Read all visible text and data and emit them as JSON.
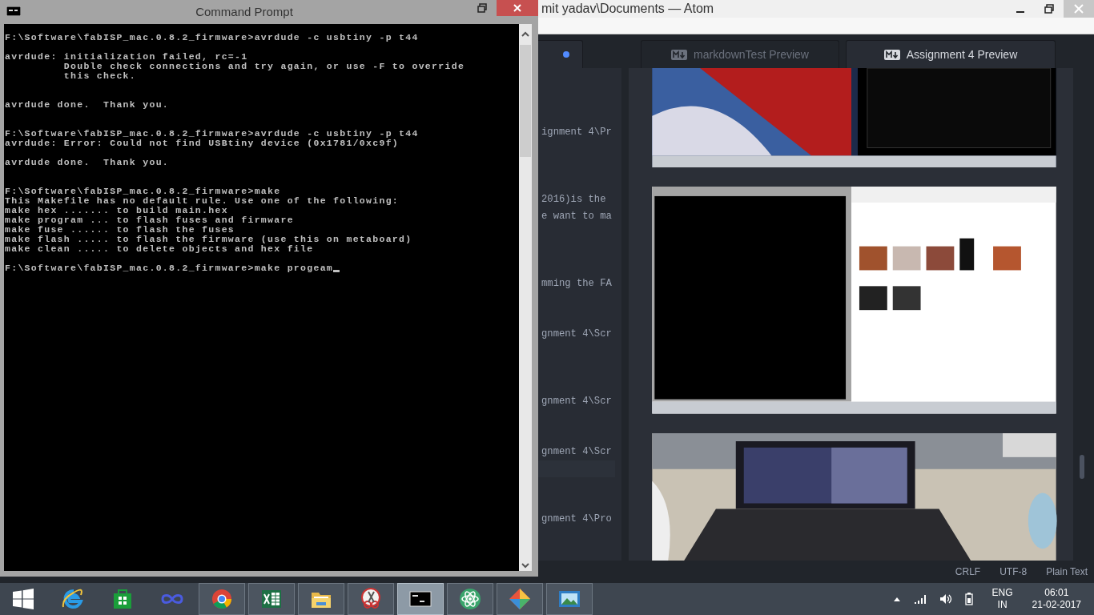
{
  "atom_window": {
    "title": "mit yadav\\Documents — Atom",
    "editor_pane": {
      "tab": {
        "modified": true
      },
      "lines": [
        {
          "kind": "blank"
        },
        {
          "kind": "blank"
        },
        {
          "kind": "blank"
        },
        {
          "kind": "text",
          "text": "ignment 4\\Pr"
        },
        {
          "kind": "blank"
        },
        {
          "kind": "blank"
        },
        {
          "kind": "blank"
        },
        {
          "kind": "text",
          "text": "2016)is the"
        },
        {
          "kind": "text",
          "text": "e want to ma"
        },
        {
          "kind": "blank"
        },
        {
          "kind": "blank"
        },
        {
          "kind": "blank"
        },
        {
          "kind": "text",
          "text": "mming the FA"
        },
        {
          "kind": "blank"
        },
        {
          "kind": "blank"
        },
        {
          "kind": "text",
          "text": "gnment 4\\Scr"
        },
        {
          "kind": "blank"
        },
        {
          "kind": "blank"
        },
        {
          "kind": "blank"
        },
        {
          "kind": "text",
          "text": "gnment 4\\Scr"
        },
        {
          "kind": "blank"
        },
        {
          "kind": "blank"
        },
        {
          "kind": "text",
          "text": "gnment 4\\Scr"
        },
        {
          "kind": "cursor-line"
        },
        {
          "kind": "blank"
        },
        {
          "kind": "blank"
        },
        {
          "kind": "text",
          "text": "gnment 4\\Pro"
        }
      ]
    },
    "preview_pane": {
      "tabs": [
        {
          "label": "markdownTest Preview",
          "selected": false
        },
        {
          "label": "Assignment 4 Preview",
          "selected": true
        }
      ]
    },
    "status_bar": [
      "CRLF",
      "UTF-8",
      "Plain Text"
    ]
  },
  "console_window": {
    "title": "Command Prompt",
    "lines": [
      {
        "kind": "text",
        "text": "F:\\Software\\fabISP_mac.0.8.2_firmware>avrdude -c usbtiny -p t44"
      },
      {
        "kind": "blank"
      },
      {
        "kind": "text",
        "text": "avrdude: initialization failed, rc=-1"
      },
      {
        "kind": "text",
        "text": "         Double check connections and try again, or use -F to override"
      },
      {
        "kind": "text",
        "text": "         this check."
      },
      {
        "kind": "blank"
      },
      {
        "kind": "blank"
      },
      {
        "kind": "text",
        "text": "avrdude done.  Thank you."
      },
      {
        "kind": "blank"
      },
      {
        "kind": "blank"
      },
      {
        "kind": "text",
        "text": "F:\\Software\\fabISP_mac.0.8.2_firmware>avrdude -c usbtiny -p t44"
      },
      {
        "kind": "text",
        "text": "avrdude: Error: Could not find USBtiny device (0x1781/0xc9f)"
      },
      {
        "kind": "blank"
      },
      {
        "kind": "text",
        "text": "avrdude done.  Thank you."
      },
      {
        "kind": "blank"
      },
      {
        "kind": "blank"
      },
      {
        "kind": "text",
        "text": "F:\\Software\\fabISP_mac.0.8.2_firmware>make"
      },
      {
        "kind": "text",
        "text": "This Makefile has no default rule. Use one of the following:"
      },
      {
        "kind": "text",
        "text": "make hex ....... to build main.hex"
      },
      {
        "kind": "text",
        "text": "make program ... to flash fuses and firmware"
      },
      {
        "kind": "text",
        "text": "make fuse ...... to flash the fuses"
      },
      {
        "kind": "text",
        "text": "make flash ..... to flash the firmware (use this on metaboard)"
      },
      {
        "kind": "text",
        "text": "make clean ..... to delete objects and hex file"
      },
      {
        "kind": "blank"
      },
      {
        "kind": "input",
        "text": "F:\\Software\\fabISP_mac.0.8.2_firmware>make progeam"
      }
    ]
  },
  "taskbar": {
    "apps": [
      {
        "kind": "ie",
        "running": false,
        "selected": false
      },
      {
        "kind": "store",
        "running": false,
        "selected": false
      },
      {
        "kind": "infinity",
        "running": false,
        "selected": false
      },
      {
        "kind": "chrome",
        "running": true,
        "selected": false
      },
      {
        "kind": "excel",
        "running": true,
        "selected": false
      },
      {
        "kind": "folder",
        "running": true,
        "selected": false
      },
      {
        "kind": "snip",
        "running": true,
        "selected": false
      },
      {
        "kind": "console",
        "running": true,
        "selected": true
      },
      {
        "kind": "atom",
        "running": true,
        "selected": false
      },
      {
        "kind": "diamond",
        "running": true,
        "selected": false
      },
      {
        "kind": "viewer",
        "running": true,
        "selected": false
      }
    ],
    "tray": {
      "language": "ENG",
      "region": "IN",
      "time": "06:01",
      "date": "21-02-2017"
    }
  }
}
